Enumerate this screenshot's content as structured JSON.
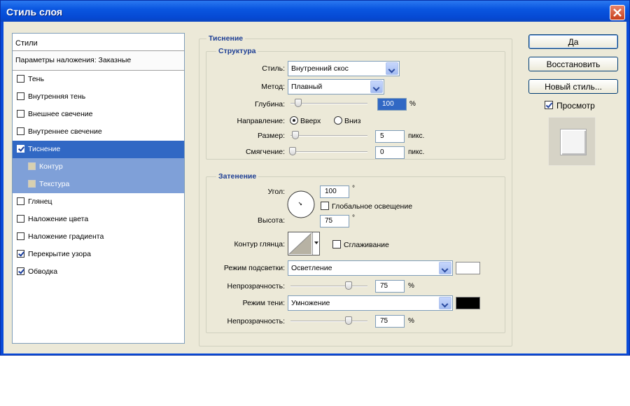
{
  "window": {
    "title": "Стиль слоя"
  },
  "styles": {
    "header": "Стили",
    "blend": "Параметры наложения: Заказные",
    "items": [
      {
        "label": "Тень",
        "checked": false
      },
      {
        "label": "Внутренняя тень",
        "checked": false
      },
      {
        "label": "Внешнее свечение",
        "checked": false
      },
      {
        "label": "Внутреннее свечение",
        "checked": false
      },
      {
        "label": "Тиснение",
        "checked": true
      },
      {
        "label": "Контур",
        "checked": false
      },
      {
        "label": "Текстура",
        "checked": false
      },
      {
        "label": "Глянец",
        "checked": false
      },
      {
        "label": "Наложение цвета",
        "checked": false
      },
      {
        "label": "Наложение градиента",
        "checked": false
      },
      {
        "label": "Перекрытие узора",
        "checked": true
      },
      {
        "label": "Обводка",
        "checked": true
      }
    ]
  },
  "bevel": {
    "section_title": "Тиснение",
    "structure": {
      "title": "Структура",
      "style_label": "Стиль:",
      "style_value": "Внутренний скос",
      "method_label": "Метод:",
      "method_value": "Плавный",
      "depth_label": "Глубина:",
      "depth_value": "100",
      "depth_unit": "%",
      "direction_label": "Направление:",
      "dir_up": "Вверх",
      "dir_down": "Вниз",
      "size_label": "Размер:",
      "size_value": "5",
      "size_unit": "пикс.",
      "soften_label": "Смягчение:",
      "soften_value": "0",
      "soften_unit": "пикс."
    },
    "shading": {
      "title": "Затенение",
      "angle_label": "Угол:",
      "angle_value": "100",
      "degree": "°",
      "global_light": "Глобальное освещение",
      "altitude_label": "Высота:",
      "altitude_value": "75",
      "gloss_label": "Контур глянца:",
      "antialias": "Сглаживание",
      "highlight_label": "Режим подсветки:",
      "highlight_value": "Осветление",
      "highlight_color": "#ffffff",
      "op1_label": "Непрозрачность:",
      "op1_value": "75",
      "op_unit": "%",
      "shadow_label": "Режим тени:",
      "shadow_value": "Умножение",
      "shadow_color": "#000000",
      "op2_label": "Непрозрачность:",
      "op2_value": "75"
    }
  },
  "buttons": {
    "ok": "Да",
    "reset": "Восстановить",
    "new_style": "Новый стиль...",
    "preview": "Просмотр"
  }
}
